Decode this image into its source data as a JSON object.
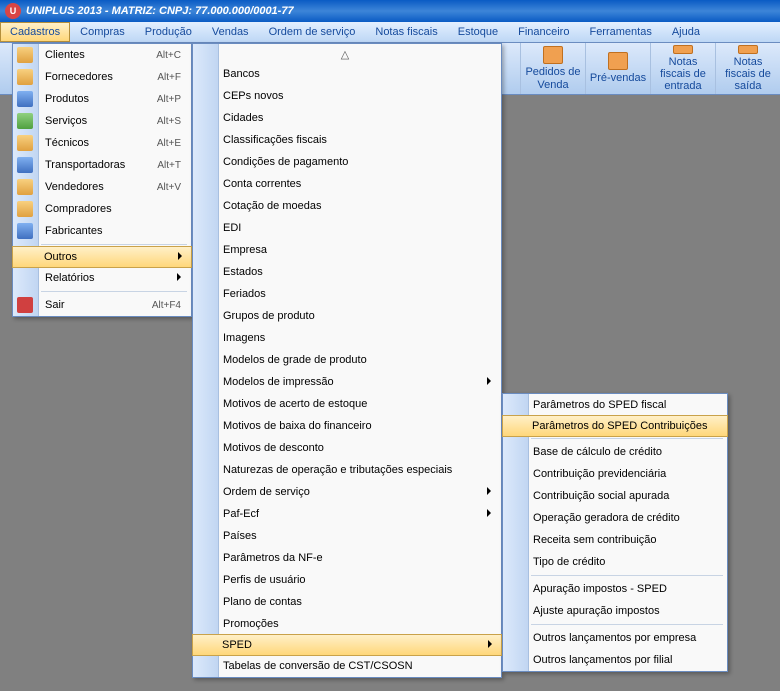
{
  "title": "UNIPLUS  2013 - MATRIZ:        CNPJ: 77.000.000/0001-77",
  "menubar": [
    "Cadastros",
    "Compras",
    "Produção",
    "Vendas",
    "Ordem de serviço",
    "Notas fiscais",
    "Estoque",
    "Financeiro",
    "Ferramentas",
    "Ajuda"
  ],
  "toolbar": [
    {
      "label": "Pedidos de Venda"
    },
    {
      "label": "Pré-vendas"
    },
    {
      "label": "Notas fiscais de entrada"
    },
    {
      "label": "Notas fiscais de saída"
    }
  ],
  "menu1": [
    {
      "label": "Clientes",
      "shortcut": "Alt+C",
      "icon": "ico-person"
    },
    {
      "label": "Fornecedores",
      "shortcut": "Alt+F",
      "icon": "ico-person"
    },
    {
      "label": "Produtos",
      "shortcut": "Alt+P",
      "icon": "ico-blue"
    },
    {
      "label": "Serviços",
      "shortcut": "Alt+S",
      "icon": "ico-green"
    },
    {
      "label": "Técnicos",
      "shortcut": "Alt+E",
      "icon": "ico-person"
    },
    {
      "label": "Transportadoras",
      "shortcut": "Alt+T",
      "icon": "ico-blue"
    },
    {
      "label": "Vendedores",
      "shortcut": "Alt+V",
      "icon": "ico-person"
    },
    {
      "label": "Compradores",
      "shortcut": "",
      "icon": "ico-person"
    },
    {
      "label": "Fabricantes",
      "shortcut": "",
      "icon": "ico-blue"
    }
  ],
  "menu1b": [
    {
      "label": "Outros",
      "arrow": true,
      "highlight": true
    },
    {
      "label": "Relatórios",
      "arrow": true
    }
  ],
  "menu1c": [
    {
      "label": "Sair",
      "shortcut": "Alt+F4",
      "icon": "ico-red"
    }
  ],
  "menu2": [
    {
      "label": "Bancos"
    },
    {
      "label": "CEPs novos"
    },
    {
      "label": "Cidades"
    },
    {
      "label": "Classificações fiscais"
    },
    {
      "label": "Condições de pagamento"
    },
    {
      "label": "Conta correntes"
    },
    {
      "label": "Cotação de moedas"
    },
    {
      "label": "EDI"
    },
    {
      "label": "Empresa"
    },
    {
      "label": "Estados"
    },
    {
      "label": "Feriados"
    },
    {
      "label": "Grupos de produto"
    },
    {
      "label": "Imagens"
    },
    {
      "label": "Modelos de grade de produto"
    },
    {
      "label": "Modelos de impressão",
      "arrow": true
    },
    {
      "label": "Motivos de acerto de estoque"
    },
    {
      "label": "Motivos de baixa do financeiro"
    },
    {
      "label": "Motivos de desconto"
    },
    {
      "label": "Naturezas de operação e tributações especiais"
    },
    {
      "label": "Ordem de serviço",
      "arrow": true
    },
    {
      "label": "Paf-Ecf",
      "arrow": true
    },
    {
      "label": "Países"
    },
    {
      "label": "Parâmetros da NF-e"
    },
    {
      "label": "Perfis de usuário"
    },
    {
      "label": "Plano de contas"
    },
    {
      "label": "Promoções"
    },
    {
      "label": "SPED",
      "arrow": true,
      "highlight": true
    },
    {
      "label": "Tabelas de conversão de CST/CSOSN"
    }
  ],
  "menu3a": [
    {
      "label": "Parâmetros do SPED fiscal"
    },
    {
      "label": "Parâmetros do SPED Contribuições",
      "highlight": true
    }
  ],
  "menu3b": [
    {
      "label": "Base de cálculo de crédito"
    },
    {
      "label": "Contribuição previdenciária"
    },
    {
      "label": "Contribuição social apurada"
    },
    {
      "label": "Operação geradora de crédito"
    },
    {
      "label": "Receita sem contribuição"
    },
    {
      "label": "Tipo de crédito"
    }
  ],
  "menu3c": [
    {
      "label": "Apuração impostos - SPED"
    },
    {
      "label": "Ajuste apuração impostos"
    }
  ],
  "menu3d": [
    {
      "label": "Outros lançamentos por empresa"
    },
    {
      "label": "Outros lançamentos por filial"
    }
  ]
}
